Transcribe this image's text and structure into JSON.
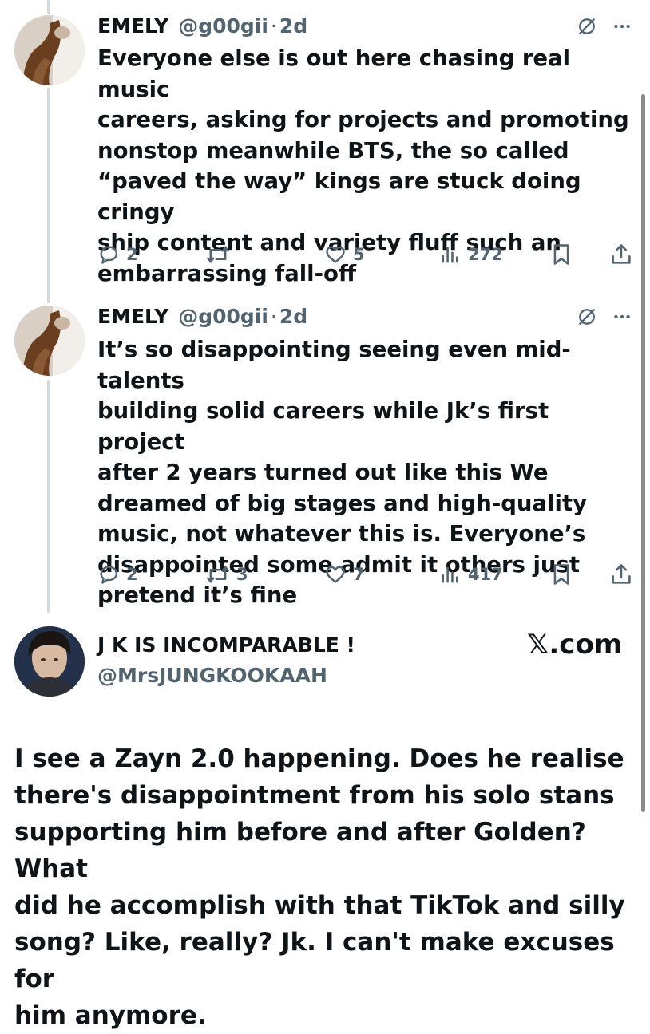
{
  "tweets": [
    {
      "author_name": "EMELY",
      "handle": "@g00gii",
      "separator": "·",
      "time_ago": "2d",
      "text": "Everyone else is out here chasing real music\ncareers, asking for projects and promoting\nnonstop meanwhile BTS, the so called\n“paved the way” kings are stuck doing cringy\nship content and variety fluff such an\nembarrassing fall-off",
      "replies": "2",
      "reposts": "",
      "likes": "5",
      "views": "272",
      "icons": [
        "hide-reply-icon",
        "more-options-icon",
        "reply-icon",
        "repost-icon",
        "like-icon",
        "views-icon",
        "bookmark-icon",
        "share-icon"
      ]
    },
    {
      "author_name": "EMELY",
      "handle": "@g00gii",
      "separator": "·",
      "time_ago": "2d",
      "text": "It’s so disappointing seeing even mid-talents\nbuilding solid careers while Jk’s first project\nafter 2 years turned out like this  We\ndreamed of big stages and high-quality\nmusic, not whatever this is. Everyone’s\ndisappointed some admit it others just\npretend it’s fine",
      "replies": "2",
      "reposts": "3",
      "likes": "7",
      "views": "417",
      "icons": [
        "hide-reply-icon",
        "more-options-icon",
        "reply-icon",
        "repost-icon",
        "like-icon",
        "views-icon",
        "bookmark-icon",
        "share-icon"
      ]
    }
  ],
  "quote_post": {
    "author_name": "J K IS INCOMPARABLE !",
    "handle": "@MrsJUNGKOOKAAH",
    "site_mark": "𝕏.com",
    "text": "I see a Zayn 2.0 happening. Does he realise\nthere's disappointment from his solo stans\nsupporting him before and after Golden? What\ndid he accomplish with that TikTok and silly\nsong? Like, really? Jk. I can't make excuses for\nhim anymore."
  },
  "colors": {
    "text": "#0f1419",
    "secondary": "#536471",
    "thread_line": "#cfd9de",
    "background": "#ffffff"
  }
}
